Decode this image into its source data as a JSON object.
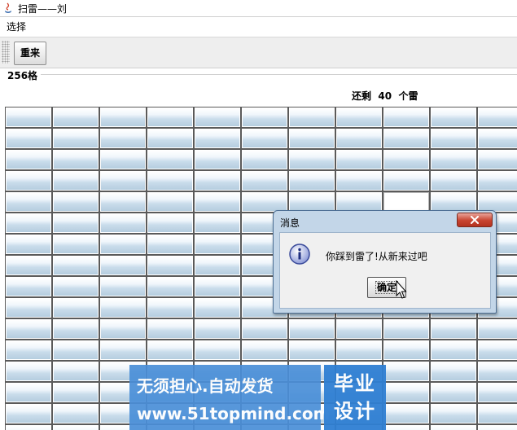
{
  "window": {
    "title": "扫雷——刘"
  },
  "menu": {
    "items": [
      "选择"
    ]
  },
  "toolbar": {
    "restart_label": "重来"
  },
  "board": {
    "cell_count_label": "256格",
    "status": {
      "prefix": "还剩",
      "count": "40",
      "suffix": "个雷"
    }
  },
  "dialog": {
    "title": "消息",
    "message": "你踩到雷了!从新来过吧",
    "ok_label": "确定"
  },
  "watermark": {
    "slogan": "无须担心.自动发货",
    "url": "www.51topmind.com",
    "badge_line1": "毕业",
    "badge_line2": "设计"
  },
  "colors": {
    "dialog_frame": "#c3d6e8",
    "close_button": "#c8432f",
    "watermark_blue": "#4a8fd8"
  }
}
